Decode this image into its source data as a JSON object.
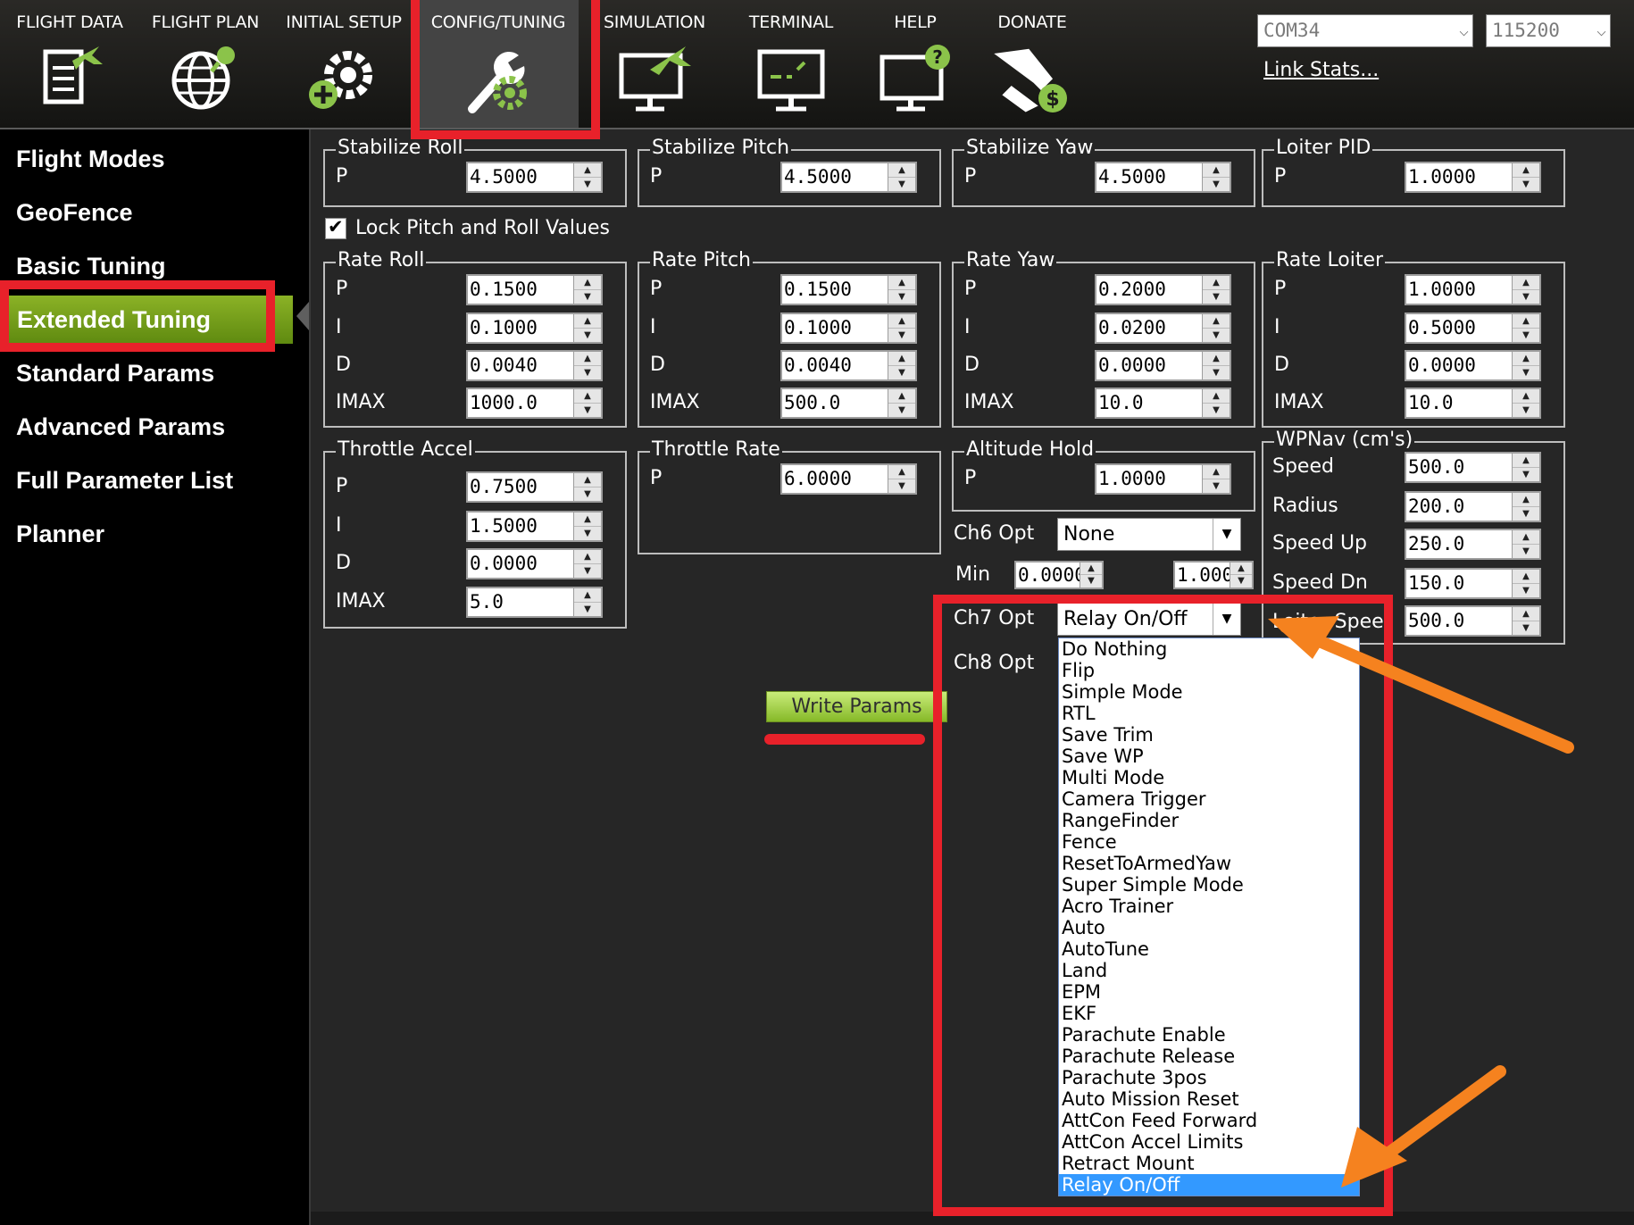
{
  "topbar": {
    "menu": [
      {
        "label": "FLIGHT DATA",
        "icon": "flight-data-icon"
      },
      {
        "label": "FLIGHT PLAN",
        "icon": "flight-plan-icon"
      },
      {
        "label": "INITIAL SETUP",
        "icon": "initial-setup-icon"
      },
      {
        "label": "CONFIG/TUNING",
        "icon": "config-tuning-icon"
      },
      {
        "label": "SIMULATION",
        "icon": "simulation-icon"
      },
      {
        "label": "TERMINAL",
        "icon": "terminal-icon"
      },
      {
        "label": "HELP",
        "icon": "help-icon"
      },
      {
        "label": "DONATE",
        "icon": "donate-icon"
      }
    ],
    "port": "COM34",
    "baud": "115200",
    "link_stats": "Link Stats..."
  },
  "sidebar": {
    "items": [
      {
        "label": "Flight Modes"
      },
      {
        "label": "GeoFence"
      },
      {
        "label": "Basic Tuning"
      },
      {
        "label": "Extended Tuning"
      },
      {
        "label": "Standard Params"
      },
      {
        "label": "Advanced Params"
      },
      {
        "label": "Full Parameter List"
      },
      {
        "label": "Planner"
      }
    ],
    "active": "Extended Tuning"
  },
  "groups": {
    "stabilize_roll": {
      "title": "Stabilize Roll",
      "rows": [
        {
          "label": "P",
          "value": "4.5000"
        }
      ]
    },
    "stabilize_pitch": {
      "title": "Stabilize Pitch",
      "rows": [
        {
          "label": "P",
          "value": "4.5000"
        }
      ]
    },
    "stabilize_yaw": {
      "title": "Stabilize Yaw",
      "rows": [
        {
          "label": "P",
          "value": "4.5000"
        }
      ]
    },
    "loiter_pid": {
      "title": "Loiter PID",
      "rows": [
        {
          "label": "P",
          "value": "1.0000"
        }
      ]
    },
    "rate_roll": {
      "title": "Rate Roll",
      "rows": [
        {
          "label": "P",
          "value": "0.1500"
        },
        {
          "label": "I",
          "value": "0.1000"
        },
        {
          "label": "D",
          "value": "0.0040"
        },
        {
          "label": "IMAX",
          "value": "1000.0"
        }
      ]
    },
    "rate_pitch": {
      "title": "Rate Pitch",
      "rows": [
        {
          "label": "P",
          "value": "0.1500"
        },
        {
          "label": "I",
          "value": "0.1000"
        },
        {
          "label": "D",
          "value": "0.0040"
        },
        {
          "label": "IMAX",
          "value": "500.0"
        }
      ]
    },
    "rate_yaw": {
      "title": "Rate Yaw",
      "rows": [
        {
          "label": "P",
          "value": "0.2000"
        },
        {
          "label": "I",
          "value": "0.0200"
        },
        {
          "label": "D",
          "value": "0.0000"
        },
        {
          "label": "IMAX",
          "value": "10.0"
        }
      ]
    },
    "rate_loiter": {
      "title": "Rate Loiter",
      "rows": [
        {
          "label": "P",
          "value": "1.0000"
        },
        {
          "label": "I",
          "value": "0.5000"
        },
        {
          "label": "D",
          "value": "0.0000"
        },
        {
          "label": "IMAX",
          "value": "10.0"
        }
      ]
    },
    "throttle_accel": {
      "title": "Throttle Accel",
      "rows": [
        {
          "label": "P",
          "value": "0.7500"
        },
        {
          "label": "I",
          "value": "1.5000"
        },
        {
          "label": "D",
          "value": "0.0000"
        },
        {
          "label": "IMAX",
          "value": "5.0"
        }
      ]
    },
    "throttle_rate": {
      "title": "Throttle Rate",
      "rows": [
        {
          "label": "P",
          "value": "6.0000"
        }
      ]
    },
    "altitude_hold": {
      "title": "Altitude Hold",
      "rows": [
        {
          "label": "P",
          "value": "1.0000"
        }
      ]
    },
    "wpnav": {
      "title": "WPNav (cm's)",
      "rows": [
        {
          "label": "Speed",
          "value": "500.0"
        },
        {
          "label": "Radius",
          "value": "200.0"
        },
        {
          "label": "Speed Up",
          "value": "250.0"
        },
        {
          "label": "Speed Dn",
          "value": "150.0"
        },
        {
          "label": "Loiter Spee",
          "value": "500.0"
        }
      ]
    }
  },
  "lock": {
    "label": "Lock Pitch and Roll Values",
    "checked": true
  },
  "ch6": {
    "label": "Ch6 Opt",
    "value": "None",
    "min_label": "Min",
    "min": "0.0000",
    "max": "1.000"
  },
  "ch7": {
    "label": "Ch7 Opt",
    "value": "Relay On/Off"
  },
  "ch8": {
    "label": "Ch8 Opt"
  },
  "write_params": "Write Params",
  "ch7_options": [
    "Do Nothing",
    "Flip",
    "Simple Mode",
    "RTL",
    "Save Trim",
    "Save WP",
    "Multi Mode",
    "Camera Trigger",
    "RangeFinder",
    "Fence",
    "ResetToArmedYaw",
    "Super Simple Mode",
    "Acro Trainer",
    "Auto",
    "AutoTune",
    "Land",
    "EPM",
    "EKF",
    "Parachute Enable",
    "Parachute Release",
    "Parachute 3pos",
    "Auto Mission Reset",
    "AttCon Feed Forward",
    "AttCon Accel Limits",
    "Retract Mount",
    "Relay On/Off"
  ],
  "ch7_selected": "Relay On/Off",
  "colors": {
    "accent_green": "#86b928",
    "annotation_red": "#e8212a",
    "annotation_orange": "#f5821f",
    "highlight_blue": "#3399ff"
  }
}
